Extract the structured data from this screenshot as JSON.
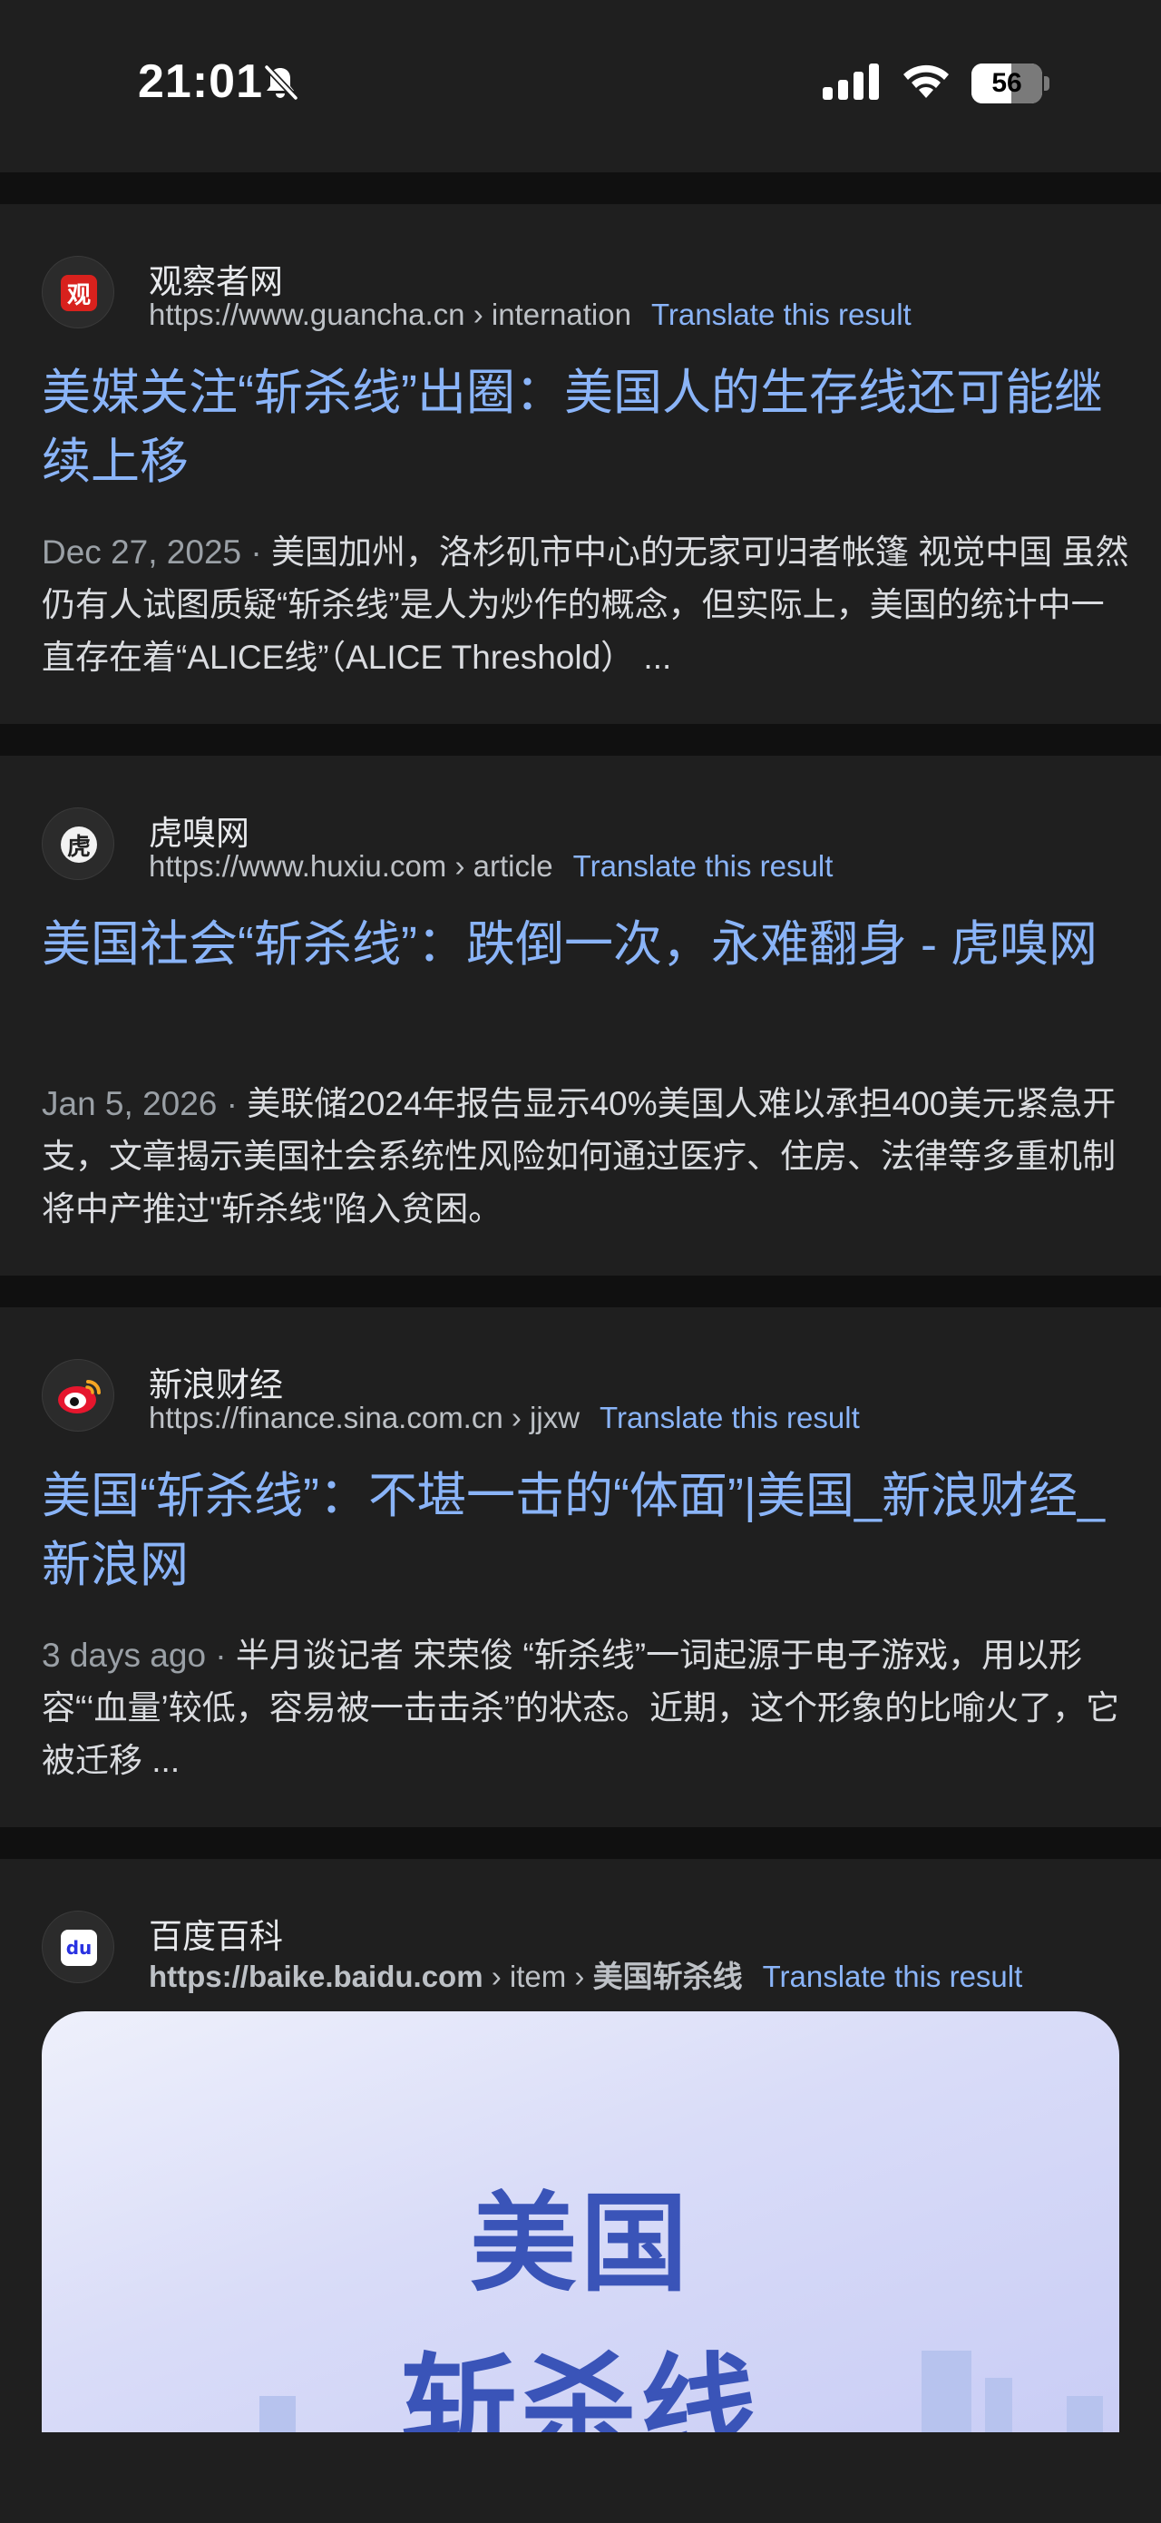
{
  "status_bar": {
    "time": "21:01",
    "battery_level": "56",
    "icons": [
      "bell-slash-icon",
      "cellular-signal-icon",
      "wifi-icon",
      "battery-icon"
    ]
  },
  "results": [
    {
      "site_name": "观察者网",
      "url": "https://www.guancha.cn",
      "crumbs": "› internation",
      "translate": "Translate this result",
      "title": "美媒关注“斩杀线”出圈：美国人的生存线还可能继续上移",
      "date": "Dec 27, 2025 ·",
      "snippet": "美国加州，洛杉矶市中心的无家可归者帐篷 视觉中国 虽然仍有人试图质疑“斩杀线”是人为炒作的概念，但实际上，美国的统计中一直存在着“ALICE线”（ALICE Threshold） ...",
      "favicon_glyph": "观"
    },
    {
      "site_name": "虎嗅网",
      "url": "https://www.huxiu.com",
      "crumbs": "› article",
      "translate": "Translate this result",
      "title": "美国社会“斩杀线”：跌倒一次，永难翻身 - 虎嗅网",
      "date": "Jan 5, 2026 ·",
      "snippet": "美联储2024年报告显示40%美国人难以承担400美元紧急开支，文章揭示美国社会系统性风险如何通过医疗、住房、法律等多重机制将中产推过\"斩杀线\"陷入贫困。",
      "favicon_glyph": "虎"
    },
    {
      "site_name": "新浪财经",
      "url": "https://finance.sina.com.cn",
      "crumbs": "› jjxw",
      "translate": "Translate this result",
      "title": "美国“斩杀线”：不堪一击的“体面”|美国_新浪财经_新浪网",
      "date": "3 days ago ·",
      "snippet": "半月谈记者 宋荣俊 “斩杀线”一词起源于电子游戏，用以形容“‘血量’较低，容易被一击击杀”的状态。近期，这个形象的比喻火了，它被迁移 ...",
      "favicon_glyph": "浪"
    },
    {
      "site_name": "百度百科",
      "url_bold": "https://baike.baidu.com",
      "crumbs_plain": "› item ›",
      "crumbs_bold": "美国斩杀线",
      "translate": "Translate this result",
      "favicon_glyph": "du",
      "image_text_line1": "美国",
      "image_text_line2": "斩杀线"
    }
  ]
}
